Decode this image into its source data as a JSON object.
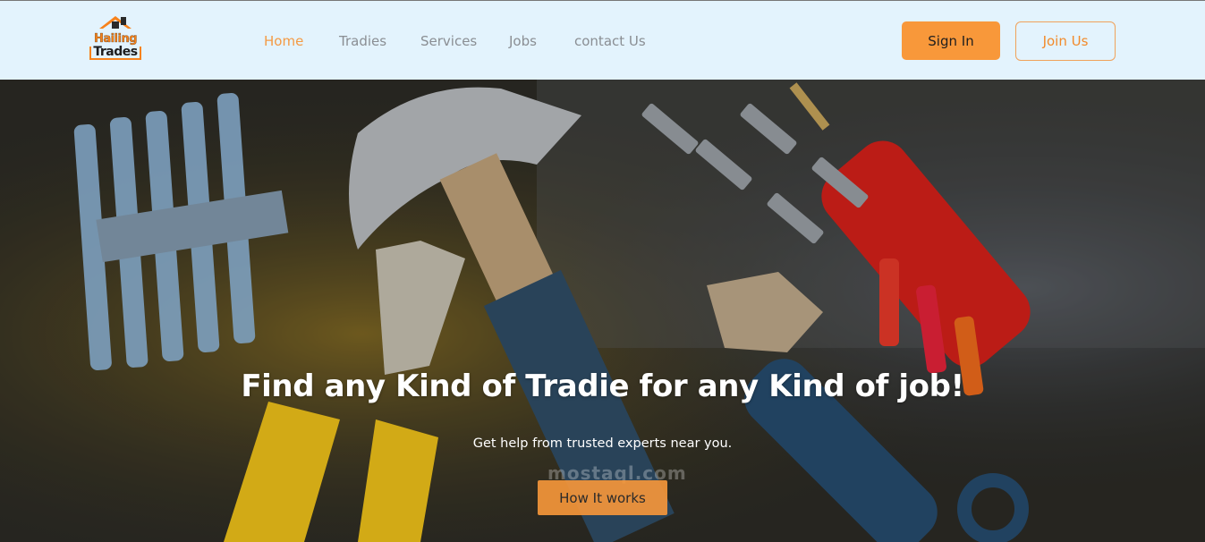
{
  "brand": {
    "logo_line1": "Hailing",
    "logo_line2": "Trades",
    "accent": "#f8983a",
    "header_bg": "#e3f3fd"
  },
  "nav": {
    "items": [
      {
        "label": "Home",
        "active": true
      },
      {
        "label": "Tradies",
        "active": false
      },
      {
        "label": "Services",
        "active": false
      },
      {
        "label": "Jobs",
        "active": false
      },
      {
        "label": "contact Us",
        "active": false
      }
    ]
  },
  "auth": {
    "sign_in_label": "Sign In",
    "join_label": "Join Us"
  },
  "hero": {
    "title": "Find any Kind of Tradie for any Kind of job!",
    "subtitle": "Get help from trusted experts near you.",
    "cta_label": "How It works",
    "background_image": "tools-on-workbench-image",
    "watermark": "mostaql.com"
  }
}
